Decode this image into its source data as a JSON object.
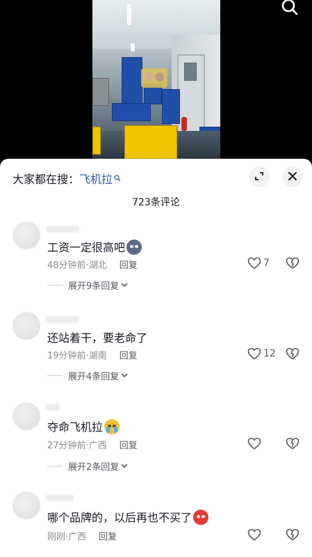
{
  "video": {
    "search_icon": "search-icon"
  },
  "sheet": {
    "search_prefix": "大家都在搜：",
    "search_keyword": "飞机拉",
    "comment_count": "723条评论",
    "expand_icon": "expand-icon",
    "close_icon": "close-icon"
  },
  "comments": [
    {
      "text": "工资一定很高吧",
      "emoji": "cool-face-emoji",
      "time": "48分钟前",
      "location": "湖北",
      "reply_label": "回复",
      "likes": "7",
      "expand_label": "展开9条回复"
    },
    {
      "text": "还站着干，要老命了",
      "emoji": "",
      "time": "19分钟前",
      "location": "湖南",
      "reply_label": "回复",
      "likes": "12",
      "expand_label": "展开4条回复"
    },
    {
      "text": "夺命飞机拉",
      "emoji": "crying-face-emoji",
      "time": "27分钟前",
      "location": "广西",
      "reply_label": "回复",
      "likes": "",
      "expand_label": "展开2条回复"
    },
    {
      "text": "哪个品牌的，以后再也不买了",
      "emoji": "angry-face-emoji",
      "time": "刚刚",
      "location": "广西",
      "reply_label": "回复",
      "likes": "",
      "expand_label": ""
    }
  ],
  "meta_separator": "·",
  "colors": {
    "keyword": "#2b5ba6",
    "text": "#161823",
    "meta": "#8a8b91",
    "sheet_bg": "#ffffff"
  }
}
